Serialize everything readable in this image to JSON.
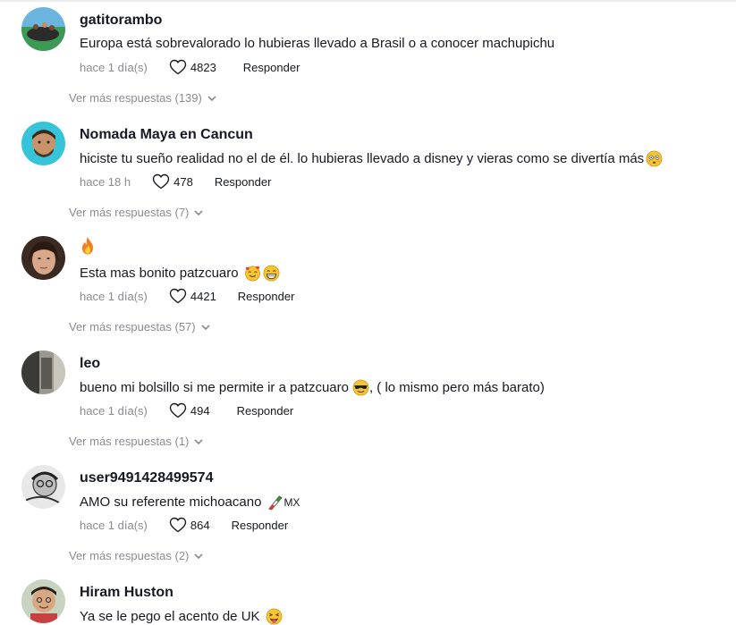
{
  "comments": [
    {
      "username": "gatitorambo",
      "text": "Europa está sobrevalorado lo hubieras llevado a Brasil o a conocer machupichu",
      "time": "hace 1 día(s)",
      "likes": "4823",
      "reply_label": "Responder",
      "more_replies": "Ver más respuestas (139)"
    },
    {
      "username": "Nomada Maya en Cancun",
      "text": "hiciste tu sueño realidad no el de él. lo hubieras llevado a disney y vieras como se divertía más",
      "time": "hace 18 h",
      "likes": "478",
      "reply_label": "Responder",
      "more_replies": "Ver más respuestas (7)"
    },
    {
      "username_icon": "fire-emoji",
      "text": "Esta mas bonito patzcuaro",
      "time": "hace 1 día(s)",
      "likes": "4421",
      "reply_label": "Responder",
      "more_replies": "Ver más respuestas (57)"
    },
    {
      "username": "leo",
      "text": "bueno mi bolsillo si me permite ir a patzcuaro",
      "text_after": ", ( lo mismo pero más barato)",
      "time": "hace 1 día(s)",
      "likes": "494",
      "reply_label": "Responder",
      "more_replies": "Ver más respuestas (1)"
    },
    {
      "username": "user9491428499574",
      "text": "AMO su referente michoacano",
      "text_after": "MX",
      "time": "hace 1 día(s)",
      "likes": "864",
      "reply_label": "Responder",
      "more_replies": "Ver más respuestas (2)"
    },
    {
      "username": "Hiram Huston",
      "text": "Ya se le pego el acento de UK"
    }
  ],
  "colors": {
    "text": "#161823",
    "muted": "#8a8b91"
  }
}
